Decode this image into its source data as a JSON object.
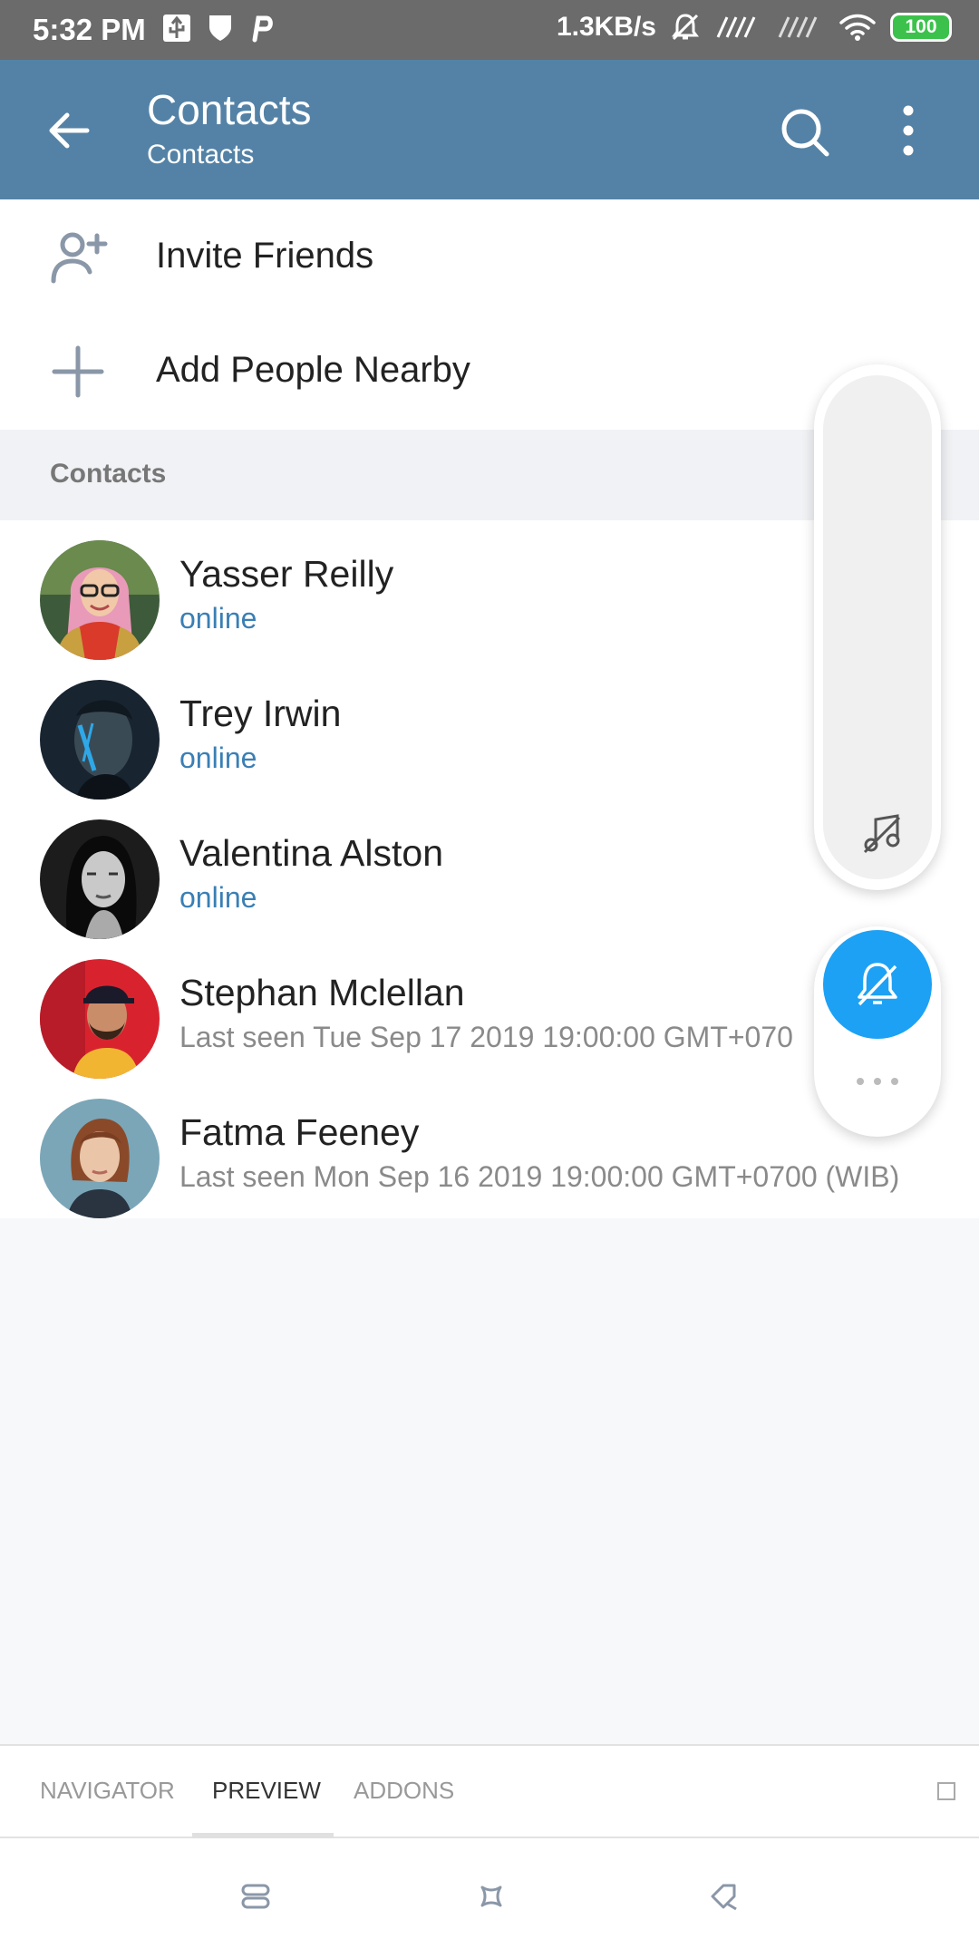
{
  "status_bar": {
    "time": "5:32 PM",
    "speed": "1.3KB/s",
    "battery": "100",
    "icons": [
      "usb-icon",
      "shield-icon",
      "p-icon",
      "mute-icon",
      "signal-icon",
      "signal-icon",
      "wifi-icon",
      "battery-icon"
    ]
  },
  "app_bar": {
    "title": "Contacts",
    "subtitle": "Contacts",
    "color": "#5482a6"
  },
  "actions": [
    {
      "label": "Invite Friends",
      "icon": "add-person-icon"
    },
    {
      "label": "Add People Nearby",
      "icon": "plus-icon"
    }
  ],
  "section_header": "Contacts",
  "contacts": [
    {
      "name": "Yasser Reilly",
      "status": "online",
      "online": true
    },
    {
      "name": "Trey Irwin",
      "status": "online",
      "online": true
    },
    {
      "name": "Valentina Alston",
      "status": "online",
      "online": true
    },
    {
      "name": "Stephan Mclellan",
      "status": "Last seen Tue Sep 17 2019 19:00:00 GMT+070",
      "online": false
    },
    {
      "name": "Fatma Feeney",
      "status": "Last seen Mon Sep 16 2019 19:00:00 GMT+0700 (WIB)",
      "online": false
    }
  ],
  "bottom_tabs": {
    "items": [
      "NAVIGATOR",
      "PREVIEW",
      "ADDONS"
    ],
    "active": "PREVIEW"
  },
  "colors": {
    "online": "#3a7fb5",
    "accent_bell": "#1da1f5"
  }
}
